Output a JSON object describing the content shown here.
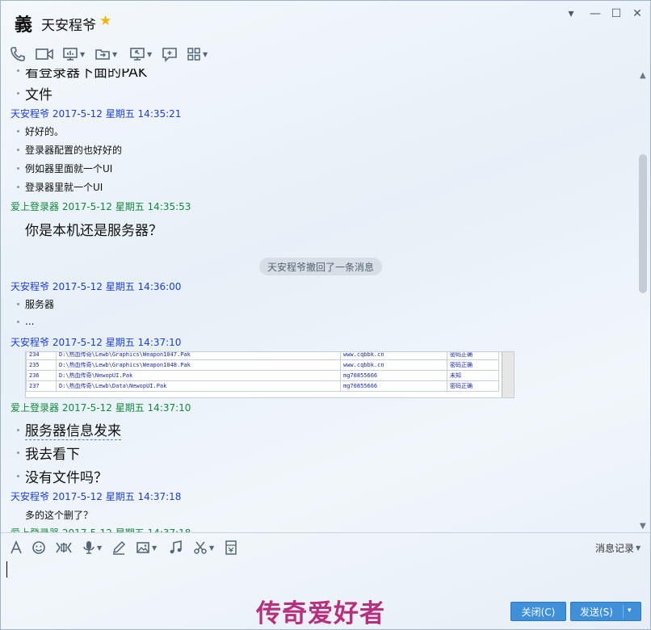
{
  "title": {
    "avatar_char": "義",
    "contact_name": "天安程爷",
    "star": "★"
  },
  "window_controls": {
    "menu": "▾",
    "minimize": "—",
    "maximize": "☐",
    "close": "✕"
  },
  "toolbar": {
    "icons": [
      "phone-icon",
      "video-icon",
      "screen-share-icon",
      "file-transfer-icon",
      "remote-desktop-icon",
      "message-board-icon",
      "apps-icon"
    ]
  },
  "messages": {
    "top_partial": "看登录器下面的PAK",
    "m0_line": "文件",
    "m1_header": "天安程爷 2017-5-12 星期五 14:35:21",
    "m1_lines": [
      "好好的。",
      "登录器配置的也好好的",
      "例如器里面就一个UI",
      "登录器里就一个UI"
    ],
    "m2_header": "爱上登录器 2017-5-12 星期五 14:35:53",
    "m2_line": "你是本机还是服务器？",
    "recall_notice": "天安程爷撤回了一条消息",
    "m3_header": "天安程爷 2017-5-12 星期五 14:36:00",
    "m3_lines": [
      "服务器",
      "..."
    ],
    "m4_header": "天安程爷 2017-5-12 星期五 14:37:10",
    "m4_table": [
      [
        "234",
        "D:\\热血传奇\\Lewb\\Graphics\\Weapon1047.Pak",
        "www.cqbbk.cn",
        "密码正确"
      ],
      [
        "235",
        "D:\\热血传奇\\Lewb\\Graphics\\Weapon1048.Pak",
        "www.cqbbk.cn",
        "密码正确"
      ],
      [
        "236",
        "D:\\热血传奇\\NewopUI.Pak",
        "mg70855666",
        "未知"
      ],
      [
        "237",
        "D:\\热血传奇\\Lewb\\Data\\NewopUI.Pak",
        "mg70855666",
        "密码正确"
      ]
    ],
    "m5_header": "爱上登录器 2017-5-12 星期五 14:37:10",
    "m5_lines": [
      "服务器信息发来",
      "我去看下",
      "没有文件吗？"
    ],
    "m6_header": "天安程爷 2017-5-12 星期五 14:37:18",
    "m6_line": "多的这个删了？",
    "m7_header_partial": "爱上登录器 2017-5-12 星期五 14:37:18"
  },
  "input_toolbar": {
    "icons": [
      "font-icon",
      "emoji-icon",
      "gif-icon",
      "voice-icon",
      "handwrite-icon",
      "image-icon",
      "music-icon",
      "screenshot-icon",
      "red-packet-icon"
    ],
    "history_label": "消息记录"
  },
  "watermark": "传奇爱好者",
  "buttons": {
    "close_label": "关闭(C)",
    "send_label": "发送(S)",
    "send_caret": "▾"
  }
}
